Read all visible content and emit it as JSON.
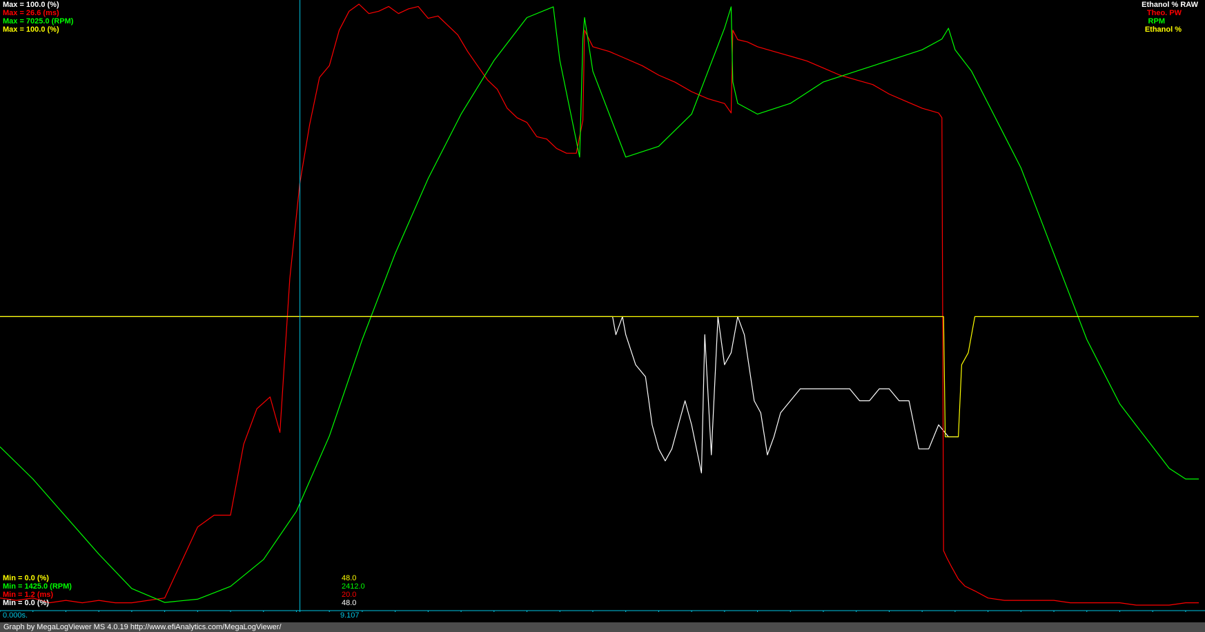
{
  "colors": {
    "background": "#000000",
    "ethanol_raw": "#ffffff",
    "theo_pw": "#ff0000",
    "rpm": "#00ff00",
    "ethanol": "#ffff00",
    "cursor": "#00c8e6",
    "axis": "#00c8e6",
    "footer_bg": "#4c4c4c"
  },
  "labels": {
    "max": [
      {
        "text": "Max = 100.0 (%)",
        "color": "#ffffff"
      },
      {
        "text": "Max = 26.6 (ms)",
        "color": "#ff0000"
      },
      {
        "text": "Max = 7025.0 (RPM)",
        "color": "#00ff00"
      },
      {
        "text": "Max = 100.0 (%)",
        "color": "#ffff00"
      }
    ],
    "min": [
      {
        "text": "Min = 0.0 (%)",
        "color": "#ffff00"
      },
      {
        "text": "Min = 1425.0 (RPM)",
        "color": "#00ff00"
      },
      {
        "text": "Min = 1.2 (ms)",
        "color": "#ff0000"
      },
      {
        "text": "Min = 0.0 (%)",
        "color": "#ffffff"
      }
    ],
    "legend": [
      {
        "text": "Ethanol % RAW",
        "color": "#ffffff"
      },
      {
        "text": "Theo. PW",
        "color": "#ff0000"
      },
      {
        "text": "RPM",
        "color": "#00ff00"
      },
      {
        "text": "Ethanol %",
        "color": "#ffff00"
      }
    ]
  },
  "cursor": {
    "time_label": "9.107",
    "values": [
      {
        "text": "48.0",
        "color": "#ffff00"
      },
      {
        "text": "2412.0",
        "color": "#00ff00"
      },
      {
        "text": "20.0",
        "color": "#ff0000"
      },
      {
        "text": "48.0",
        "color": "#ffffff"
      }
    ]
  },
  "time_axis": {
    "start_label": "0.000s."
  },
  "footer": {
    "credit": "Graph by MegaLogViewer MS 4.0.19 http://www.efiAnalytics.com/MegaLogViewer/"
  },
  "chart_data": {
    "type": "line",
    "x_unit": "s",
    "xlim": [
      0.0,
      36.4
    ],
    "cursor_x": 9.107,
    "series": [
      {
        "name": "Ethanol % RAW",
        "color": "#ffffff",
        "ylim": [
          0,
          100
        ],
        "x": [
          0,
          18.6,
          18.7,
          18.9,
          19.0,
          19.3,
          19.6,
          19.8,
          20.0,
          20.2,
          20.4,
          20.6,
          20.8,
          21.0,
          21.3,
          21.4,
          21.6,
          21.8,
          22.0,
          22.2,
          22.4,
          22.6,
          22.9,
          23.1,
          23.3,
          23.5,
          23.7,
          24.0,
          24.3,
          24.6,
          24.9,
          25.2,
          25.5,
          25.8,
          26.1,
          26.4,
          26.7,
          27.0,
          27.3,
          27.6,
          27.9,
          28.2,
          28.5,
          28.8,
          29.1
        ],
        "y": [
          48,
          48,
          45,
          48,
          45,
          40,
          38,
          30,
          26,
          24,
          26,
          30,
          34,
          30,
          22,
          45,
          25,
          48,
          40,
          42,
          48,
          45,
          34,
          32,
          25,
          28,
          32,
          34,
          36,
          36,
          36,
          36,
          36,
          36,
          34,
          34,
          36,
          36,
          34,
          34,
          26,
          26,
          30,
          28,
          28
        ]
      },
      {
        "name": "Theo. PW",
        "color": "#ff0000",
        "ylim": [
          1.2,
          26.6
        ],
        "x": [
          0,
          0.5,
          1.0,
          1.5,
          2.0,
          2.5,
          3.0,
          3.5,
          4.0,
          4.5,
          5.0,
          5.5,
          6.0,
          6.5,
          7.0,
          7.4,
          7.8,
          8.2,
          8.5,
          8.8,
          9.1,
          9.4,
          9.7,
          10.0,
          10.3,
          10.6,
          10.9,
          11.2,
          11.5,
          11.8,
          12.1,
          12.4,
          12.7,
          13.0,
          13.3,
          13.6,
          13.9,
          14.2,
          14.5,
          14.8,
          15.1,
          15.4,
          15.7,
          16.0,
          16.3,
          16.6,
          16.9,
          17.2,
          17.5,
          17.7,
          17.75,
          18.0,
          18.5,
          19.0,
          19.5,
          20.0,
          20.5,
          21.0,
          21.5,
          22.0,
          22.2,
          22.25,
          22.4,
          22.7,
          23.0,
          23.5,
          24.0,
          24.5,
          25.0,
          25.5,
          26.0,
          26.5,
          27.0,
          27.5,
          28.0,
          28.5,
          28.6,
          28.65,
          28.75,
          28.9,
          29.1,
          29.3,
          29.6,
          30.0,
          30.5,
          31.0,
          31.5,
          32.0,
          32.5,
          33.0,
          33.5,
          34.0,
          34.5,
          35.0,
          35.5,
          36.0,
          36.4
        ],
        "y": [
          1.5,
          1.4,
          1.5,
          1.3,
          1.4,
          1.3,
          1.4,
          1.3,
          1.3,
          1.4,
          1.5,
          3.0,
          4.5,
          5.0,
          5.0,
          8.0,
          9.5,
          10.0,
          8.5,
          15.0,
          19.0,
          21.5,
          23.5,
          24.0,
          25.5,
          26.3,
          26.6,
          26.2,
          26.3,
          26.5,
          26.2,
          26.4,
          26.5,
          26.0,
          26.1,
          25.7,
          25.3,
          24.6,
          24.0,
          23.4,
          23.0,
          22.2,
          21.8,
          21.6,
          21.0,
          20.9,
          20.5,
          20.3,
          20.3,
          21.7,
          25.5,
          24.8,
          24.6,
          24.3,
          24.0,
          23.6,
          23.3,
          22.9,
          22.6,
          22.4,
          22.0,
          25.5,
          25.1,
          25.0,
          24.8,
          24.6,
          24.4,
          24.2,
          23.9,
          23.6,
          23.4,
          23.2,
          22.8,
          22.5,
          22.2,
          22.0,
          21.8,
          3.5,
          3.2,
          2.8,
          2.3,
          2.0,
          1.8,
          1.5,
          1.4,
          1.4,
          1.4,
          1.4,
          1.3,
          1.3,
          1.3,
          1.3,
          1.2,
          1.2,
          1.2,
          1.3,
          1.3
        ]
      },
      {
        "name": "RPM",
        "color": "#00ff00",
        "ylim": [
          1425,
          7025
        ],
        "x": [
          0,
          1.0,
          2.0,
          3.0,
          4.0,
          5.0,
          6.0,
          7.0,
          8.0,
          9.0,
          10.0,
          11.0,
          12.0,
          13.0,
          14.0,
          15.0,
          16.0,
          16.8,
          17.0,
          17.6,
          17.7,
          17.75,
          18.0,
          19.0,
          20.0,
          21.0,
          22.0,
          22.2,
          22.25,
          22.4,
          23.0,
          24.0,
          25.0,
          26.0,
          27.0,
          28.0,
          28.6,
          28.8,
          29.0,
          29.5,
          30.0,
          30.5,
          31.0,
          31.5,
          32.0,
          32.5,
          33.0,
          33.5,
          34.0,
          34.5,
          35.0,
          35.5,
          36.0,
          36.4
        ],
        "y": [
          2900,
          2600,
          2250,
          1900,
          1580,
          1450,
          1480,
          1600,
          1850,
          2300,
          3000,
          3900,
          4700,
          5400,
          6000,
          6500,
          6900,
          7000,
          6500,
          5600,
          6700,
          6900,
          6400,
          5600,
          5700,
          6000,
          6800,
          7000,
          6300,
          6100,
          6000,
          6100,
          6300,
          6400,
          6500,
          6600,
          6700,
          6800,
          6600,
          6400,
          6100,
          5800,
          5500,
          5100,
          4700,
          4300,
          3900,
          3600,
          3300,
          3100,
          2900,
          2700,
          2600,
          2600
        ]
      },
      {
        "name": "Ethanol %",
        "color": "#ffff00",
        "ylim": [
          0,
          100
        ],
        "x": [
          0,
          28.65,
          28.7,
          29.1,
          29.2,
          29.4,
          29.6,
          36.4
        ],
        "y": [
          48,
          48,
          28,
          28,
          40,
          42,
          48,
          48
        ]
      }
    ]
  }
}
